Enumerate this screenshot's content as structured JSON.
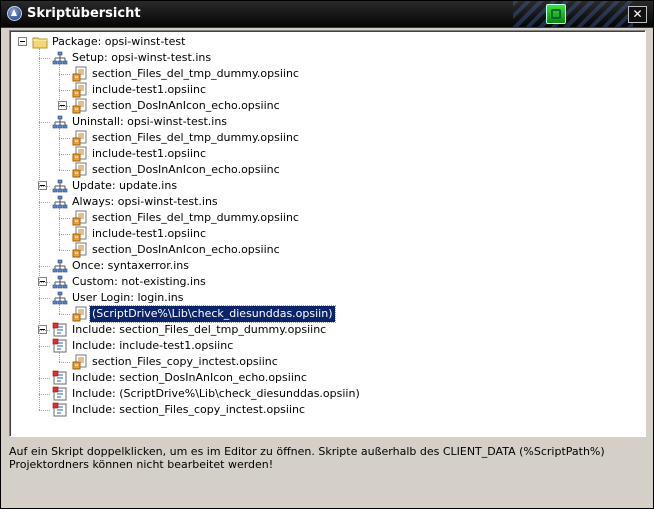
{
  "window": {
    "title": "Skriptübersicht",
    "close_label": "✕"
  },
  "tree": {
    "root": "Package: opsi-winst-test",
    "items": [
      "Setup: opsi-winst-test.ins",
      "section_Files_del_tmp_dummy.opsiinc",
      "include-test1.opsiinc",
      "section_DosInAnIcon_echo.opsiinc",
      "Uninstall: opsi-winst-test.ins",
      "section_Files_del_tmp_dummy.opsiinc",
      "include-test1.opsiinc",
      "section_DosInAnIcon_echo.opsiinc",
      "Update: update.ins",
      "Always: opsi-winst-test.ins",
      "section_Files_del_tmp_dummy.opsiinc",
      "include-test1.opsiinc",
      "section_DosInAnIcon_echo.opsiinc",
      "Once: syntaxerror.ins",
      "Custom: not-existing.ins",
      "User Login: login.ins",
      "(ScriptDrive%\\Lib\\check_diesunddas.opsiin)",
      "Include: section_Files_del_tmp_dummy.opsiinc",
      "Include: include-test1.opsiinc",
      "section_Files_copy_inctest.opsiinc",
      "Include: section_DosInAnIcon_echo.opsiinc",
      "Include: (ScriptDrive%\\Lib\\check_diesunddas.opsiin)",
      "Include: section_Files_copy_inctest.opsiinc"
    ]
  },
  "status": "Auf ein Skript doppelklicken, um es im Editor zu öffnen. Skripte außerhalb des CLIENT_DATA (%ScriptPath%) Projektordners können nicht bearbeitet werden!"
}
